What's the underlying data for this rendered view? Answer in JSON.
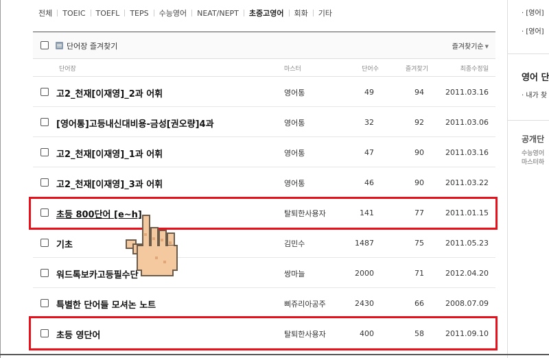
{
  "categories": [
    {
      "label": "전체",
      "active": false
    },
    {
      "label": "TOEIC",
      "active": false
    },
    {
      "label": "TOEFL",
      "active": false
    },
    {
      "label": "TEPS",
      "active": false
    },
    {
      "label": "수능영어",
      "active": false
    },
    {
      "label": "NEAT/NEPT",
      "active": false
    },
    {
      "label": "초중고영어",
      "active": true
    },
    {
      "label": "회화",
      "active": false
    },
    {
      "label": "기타",
      "active": false
    }
  ],
  "toolbar": {
    "fav_label": "단어장 즐겨찾기",
    "sort_label": "즐겨찾기순",
    "sort_caret": "▼"
  },
  "columns": {
    "title": "단어장",
    "master": "마스터",
    "count": "단어수",
    "fav": "즐겨찾기",
    "date": "최종수정일"
  },
  "rows": [
    {
      "title": "고2_천재[이재영]_2과 어휘",
      "master": "영어통",
      "count": "49",
      "fav": "94",
      "date": "2011.03.16",
      "underline": false
    },
    {
      "title": "[영어통]고등내신대비용-금성[권오량]4과",
      "master": "영어통",
      "count": "32",
      "fav": "92",
      "date": "2011.03.06",
      "underline": false
    },
    {
      "title": "고2_천재[이재영]_1과 어휘",
      "master": "영어통",
      "count": "47",
      "fav": "90",
      "date": "2011.03.16",
      "underline": false
    },
    {
      "title": "고2_천재[이재영]_3과 어휘",
      "master": "영어통",
      "count": "46",
      "fav": "90",
      "date": "2011.03.22",
      "underline": false
    },
    {
      "title": "초등 800단어 [e~h]",
      "master": "탈퇴한사용자",
      "count": "141",
      "fav": "77",
      "date": "2011.01.15",
      "underline": true
    },
    {
      "title": "기초",
      "master": "김민수",
      "count": "1487",
      "fav": "75",
      "date": "2011.05.23",
      "underline": false
    },
    {
      "title": "워드톡보카고등필수단",
      "master": "쌍마늘",
      "count": "2000",
      "fav": "71",
      "date": "2012.04.20",
      "underline": false
    },
    {
      "title": "특별한 단어들 모셔논 노트",
      "master": "삐쥬리아공주",
      "count": "2430",
      "fav": "66",
      "date": "2008.07.09",
      "underline": false
    },
    {
      "title": "초등 영단어",
      "master": "탈퇴한사용자",
      "count": "400",
      "fav": "58",
      "date": "2011.09.10",
      "underline": false
    }
  ],
  "side": {
    "bullet_1": "· [영어]",
    "bullet_2": "· [영어]",
    "section_1_title": "영어 단",
    "section_1_bullet": "· 내가 찾",
    "section_2_title": "공개단",
    "section_2_desc_1": "수능영어",
    "section_2_desc_2": "마스터하"
  },
  "colors": {
    "highlight": "#e8101b",
    "hand_skin": "#f5c9a0",
    "hand_outline": "#6b5a4a"
  }
}
